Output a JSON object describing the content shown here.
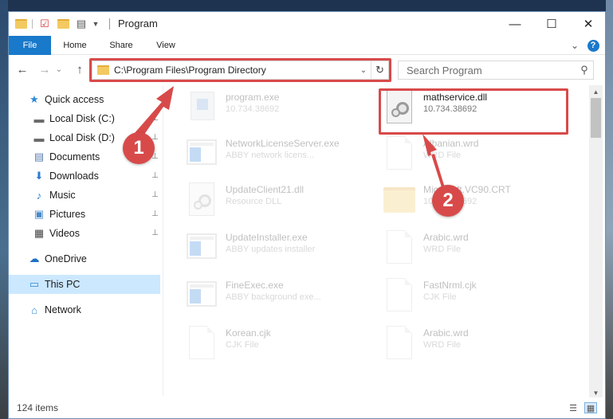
{
  "window": {
    "title": "Program",
    "controls": {
      "minimize": "—",
      "maximize": "☐",
      "close": "✕"
    }
  },
  "ribbon": {
    "tabs": [
      "File",
      "Home",
      "Share",
      "View"
    ],
    "expand_glyph": "⌄",
    "help_glyph": "?"
  },
  "nav": {
    "back_glyph": "←",
    "forward_glyph": "→",
    "recent_glyph": "⌄",
    "up_glyph": "↑",
    "address": "C:\\Program Files\\Program Directory",
    "address_chevron": "⌄",
    "refresh_glyph": "↻",
    "search_placeholder": "Search Program",
    "search_glyph": "⚲"
  },
  "sidebar": {
    "items": [
      {
        "label": "Quick access",
        "icon": "star-icon",
        "glyph": "★",
        "color": "#2d8ad8",
        "pinned": false
      },
      {
        "label": "Local Disk (C:)",
        "icon": "drive-icon",
        "glyph": "▬",
        "color": "#6a6a6a",
        "pinned": true
      },
      {
        "label": "Local Disk (D:)",
        "icon": "drive-icon",
        "glyph": "▬",
        "color": "#6a6a6a",
        "pinned": true
      },
      {
        "label": "Documents",
        "icon": "documents-icon",
        "glyph": "▤",
        "color": "#5a7db0",
        "pinned": true
      },
      {
        "label": "Downloads",
        "icon": "download-icon",
        "glyph": "⬇",
        "color": "#2d7bd0",
        "pinned": true
      },
      {
        "label": "Music",
        "icon": "music-icon",
        "glyph": "♪",
        "color": "#2d7bd0",
        "pinned": true
      },
      {
        "label": "Pictures",
        "icon": "pictures-icon",
        "glyph": "▣",
        "color": "#4a8ac8",
        "pinned": true
      },
      {
        "label": "Videos",
        "icon": "videos-icon",
        "glyph": "▦",
        "color": "#444444",
        "pinned": true
      },
      {
        "label": "OneDrive",
        "icon": "cloud-icon",
        "glyph": "☁",
        "color": "#1f6fc4",
        "pinned": false
      },
      {
        "label": "This PC",
        "icon": "computer-icon",
        "glyph": "▭",
        "color": "#2d8ad8",
        "pinned": false
      },
      {
        "label": "Network",
        "icon": "network-icon",
        "glyph": "⌂",
        "color": "#2d8ad8",
        "pinned": false
      }
    ],
    "pin_glyph": "📌"
  },
  "files": [
    {
      "name": "program.exe",
      "sub": "10.734.38692",
      "type": "exe",
      "faded": true
    },
    {
      "name": "mathservice.dll",
      "sub": "10.734.38692",
      "type": "dll",
      "faded": false
    },
    {
      "name": "NetworkLicenseServer.exe",
      "sub": "ABBY network licens...",
      "type": "app",
      "faded": true
    },
    {
      "name": "Albanian.wrd",
      "sub": "WRD File",
      "type": "doc",
      "faded": true
    },
    {
      "name": "UpdateClient21.dll",
      "sub": "Resource DLL",
      "type": "dll",
      "faded": true
    },
    {
      "name": "Microsoft.VC90.CRT",
      "sub": "10.734.38692",
      "type": "folder",
      "faded": true
    },
    {
      "name": "UpdateInstaller.exe",
      "sub": "ABBY updates installer",
      "type": "app",
      "faded": true
    },
    {
      "name": "Arabic.wrd",
      "sub": "WRD File",
      "type": "doc",
      "faded": true
    },
    {
      "name": "FineExec.exe",
      "sub": "ABBY background exe...",
      "type": "app",
      "faded": true
    },
    {
      "name": "FastNrml.cjk",
      "sub": "CJK File",
      "type": "doc",
      "faded": true
    },
    {
      "name": "Korean.cjk",
      "sub": "CJK File",
      "type": "doc",
      "faded": true
    },
    {
      "name": "Arabic.wrd",
      "sub": "WRD File",
      "type": "doc",
      "faded": true
    }
  ],
  "annotations": {
    "badge_1": "1",
    "badge_2": "2",
    "color": "#d84a4a"
  },
  "status": {
    "items": "124 items"
  }
}
